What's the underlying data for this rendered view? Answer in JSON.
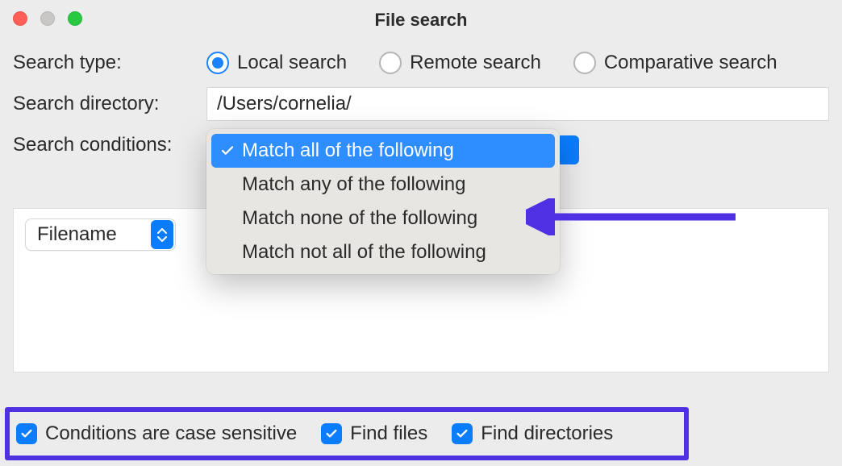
{
  "window": {
    "title": "File search"
  },
  "form": {
    "search_type_label": "Search type:",
    "search_directory_label": "Search directory:",
    "search_conditions_label": "Search conditions:",
    "directory_value": "/Users/cornelia/"
  },
  "radios": {
    "local": "Local search",
    "remote": "Remote search",
    "comparative": "Comparative search"
  },
  "dropdown": {
    "opt1": "Match all of the following",
    "opt2": "Match any of the following",
    "opt3": "Match none of the following",
    "opt4": "Match not all of the following"
  },
  "filter": {
    "field": "Filename"
  },
  "checkboxes": {
    "case_sensitive": "Conditions are case sensitive",
    "find_files": "Find files",
    "find_directories": "Find directories"
  }
}
